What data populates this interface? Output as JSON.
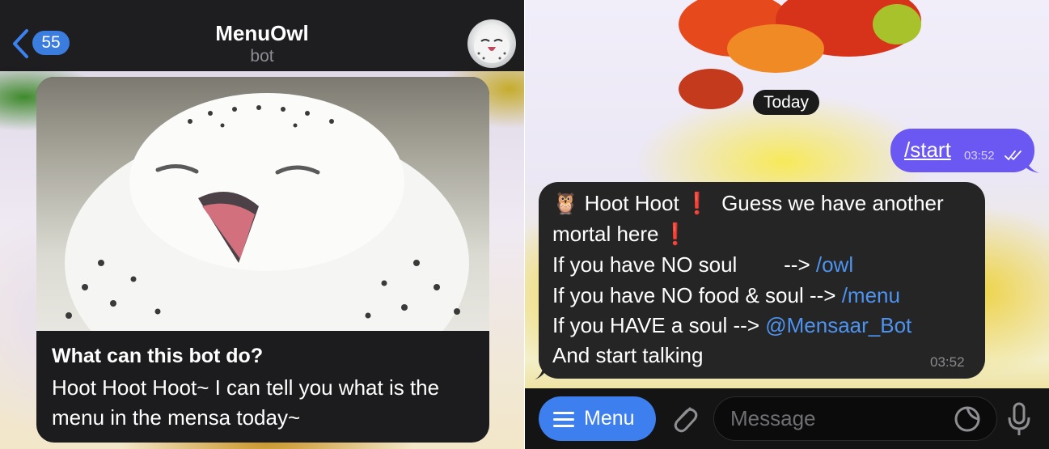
{
  "left": {
    "header": {
      "back_count": "55",
      "title": "MenuOwl",
      "subtitle": "bot"
    },
    "intro_card": {
      "heading": "What can this bot do?",
      "body": "Hoot Hoot Hoot~ I can tell you what is the menu in the mensa today~"
    }
  },
  "right": {
    "date_separator": "Today",
    "outgoing": {
      "text": "/start",
      "time": "03:52"
    },
    "incoming": {
      "emoji": "🦉",
      "line1_text": "Hoot Hoot",
      "line1_rest": "Guess we have another",
      "line2_text": "mortal here",
      "line3_text": "If you have NO soul        --> ",
      "line3_link": "/owl",
      "line4_text": "If you have NO food & soul --> ",
      "line4_link": "/menu",
      "line5_text": "If you HAVE a soul --> ",
      "line5_link": "@Mensaar_Bot",
      "line6_text": "And start talking",
      "time": "03:52"
    },
    "input_bar": {
      "menu_label": "Menu",
      "placeholder": "Message"
    }
  },
  "colors": {
    "accent_blue": "#3e7ff0",
    "outgoing_bubble": "#6b57f2",
    "link": "#4d93f0",
    "exclamation": "#e0282a"
  }
}
